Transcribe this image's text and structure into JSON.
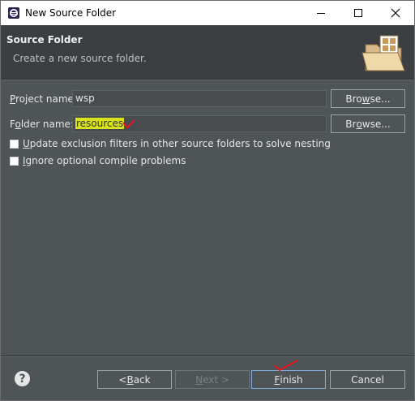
{
  "window": {
    "title": "New Source Folder",
    "icon": "eclipse-icon",
    "controls": [
      "minimize-icon",
      "maximize-icon",
      "close-icon"
    ]
  },
  "header": {
    "title": "Source Folder",
    "description": "Create a new source folder.",
    "icon": "folder-icon"
  },
  "form": {
    "project_label_mnemonic": "P",
    "project_label_rest": "roject name:",
    "project_value": "wsp",
    "project_browse_pre": "Bro",
    "project_browse_mn": "w",
    "project_browse_post": "se...",
    "folder_label_pre": "F",
    "folder_label_mn": "o",
    "folder_label_post": "lder name:",
    "folder_value": "resources",
    "folder_browse_pre": "Br",
    "folder_browse_mn": "o",
    "folder_browse_post": "wse...",
    "option1_mn": "U",
    "option1_rest": "pdate exclusion filters in other source folders to solve nesting",
    "option1_checked": false,
    "option2_mn": "I",
    "option2_rest": "gnore optional compile problems",
    "option2_checked": false
  },
  "footer": {
    "help_label": "?",
    "back_pre": "< ",
    "back_mn": "B",
    "back_post": "ack",
    "next_pre": "",
    "next_mn": "N",
    "next_post": "ext >",
    "finish_pre": "",
    "finish_mn": "F",
    "finish_post": "inish",
    "cancel_label": "Cancel"
  },
  "colors": {
    "background": "#4f5457",
    "header_background": "#3b3f42",
    "highlight": "#d7e21a",
    "annotation": "#e8141e"
  }
}
